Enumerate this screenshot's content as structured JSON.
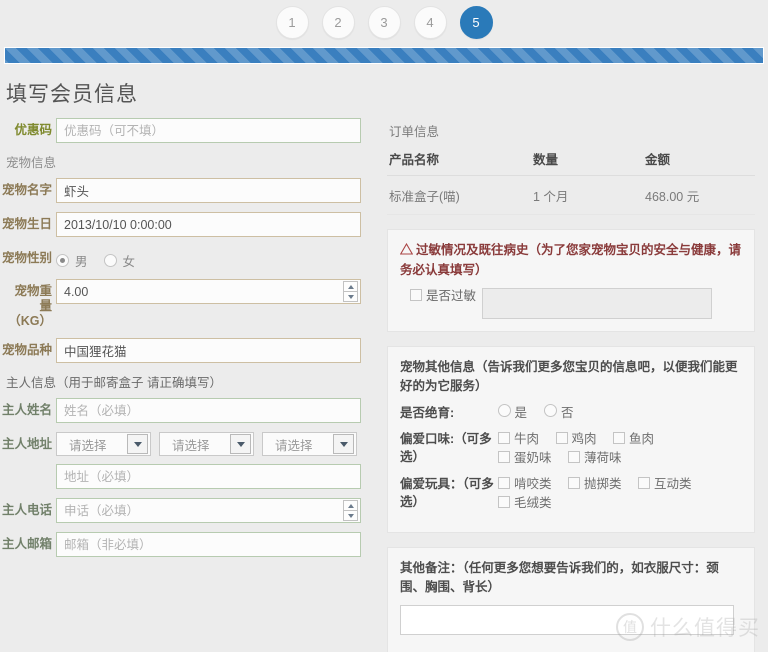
{
  "steps": {
    "items": [
      "1",
      "2",
      "3",
      "4",
      "5"
    ],
    "active_index": 4,
    "active_color": "#2a7ab9"
  },
  "progress": {
    "color": "#3a7fbf",
    "percent": 100
  },
  "page_title": "填写会员信息",
  "form": {
    "coupon": {
      "label": "优惠码",
      "placeholder": "优惠码（可不填）",
      "value": ""
    },
    "pet_section_label": "宠物信息",
    "pet_name": {
      "label": "宠物名字",
      "value": "虾头",
      "placeholder": ""
    },
    "pet_birthday": {
      "label": "宠物生日",
      "value": "2013/10/10 0:00:00",
      "placeholder": ""
    },
    "pet_gender": {
      "label": "宠物性别",
      "options": [
        "男",
        "女"
      ],
      "selected": "男"
    },
    "pet_weight": {
      "label": "宠物重量（KG）",
      "label_line1": "宠物重",
      "label_line2": "量",
      "label_line3": "（KG）",
      "value": "4.00"
    },
    "pet_breed": {
      "label": "宠物品种",
      "value": "中国狸花猫"
    },
    "owner_section_label": "主人信息（用于邮寄盒子 请正确填写）",
    "owner_name": {
      "label": "主人姓名",
      "placeholder": "姓名（必填）",
      "value": ""
    },
    "owner_address": {
      "label": "主人地址",
      "selects": [
        "请选择",
        "请选择",
        "请选择"
      ],
      "detail_placeholder": "地址（必填）",
      "detail_value": ""
    },
    "owner_phone": {
      "label": "主人电话",
      "placeholder": "申话（必填）",
      "value": ""
    },
    "owner_email": {
      "label": "主人邮箱",
      "placeholder": "邮箱（非必填）",
      "value": ""
    }
  },
  "order": {
    "title": "订单信息",
    "columns": [
      "产品名称",
      "数量",
      "金额"
    ],
    "rows": [
      {
        "product": "标准盒子(喵)",
        "qty": "1 个月",
        "amount": "468.00 元"
      }
    ]
  },
  "allergy": {
    "icon": "warning-triangle-icon",
    "heading": "过敏情况及既往病史（为了您家宠物宝贝的安全与健康，请务必认真填写）",
    "checkbox_label": "是否过敏",
    "checked": false,
    "textarea_value": ""
  },
  "pet_extra": {
    "heading": "宠物其他信息（告诉我们更多您宝贝的信息吧，以便我们能更好的为它服务）",
    "neutered": {
      "label": "是否绝育:",
      "options": [
        "是",
        "否"
      ],
      "selected": ""
    },
    "taste": {
      "label": "偏爱口味:（可多选）",
      "options": [
        "牛肉",
        "鸡肉",
        "鱼肉",
        "蛋奶味",
        "薄荷味"
      ],
      "selected": []
    },
    "toys": {
      "label": "偏爱玩具：（可多选）",
      "options": [
        "啃咬类",
        "抛掷类",
        "互动类",
        "毛绒类"
      ],
      "selected": []
    }
  },
  "notes": {
    "heading": "其他备注：（任何更多您想要告诉我们的，如衣服尺寸：颈围、胸围、背长）",
    "value": ""
  },
  "watermark": {
    "mark": "值",
    "text": "什么值得买"
  }
}
